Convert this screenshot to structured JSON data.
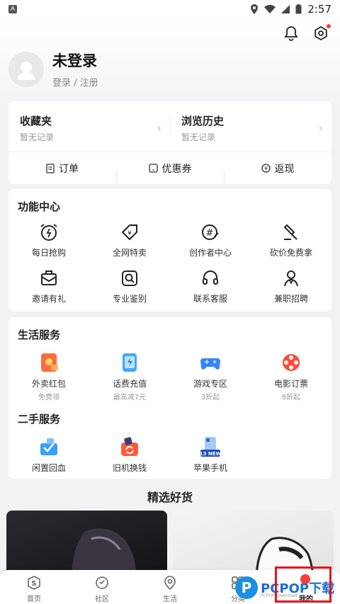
{
  "status_bar": {
    "time": "2:57"
  },
  "profile": {
    "name": "未登录",
    "sub": "登录 / 注册"
  },
  "collections": [
    {
      "title": "收藏夹",
      "sub": "暂无记录"
    },
    {
      "title": "浏览历史",
      "sub": "暂无记录"
    }
  ],
  "orders": [
    {
      "label": "订单",
      "icon": "receipt-icon"
    },
    {
      "label": "优惠券",
      "icon": "coupon-icon"
    },
    {
      "label": "返现",
      "icon": "cashback-icon"
    }
  ],
  "functions": {
    "title": "功能中心",
    "items": [
      {
        "label": "每日抢购",
        "icon": "alarm-clock-icon"
      },
      {
        "label": "全网特卖",
        "icon": "price-tag-icon"
      },
      {
        "label": "创作者中心",
        "icon": "hashtag-icon"
      },
      {
        "label": "砍价免费拿",
        "icon": "hammer-icon"
      },
      {
        "label": "邀请有礼",
        "icon": "envelope-icon"
      },
      {
        "label": "专业鉴别",
        "icon": "magnifier-icon"
      },
      {
        "label": "联系客服",
        "icon": "headset-icon"
      },
      {
        "label": "兼职招聘",
        "icon": "person-icon"
      }
    ]
  },
  "life": {
    "title": "生活服务",
    "items": [
      {
        "label": "外卖红包",
        "sub": "免费领",
        "icon": "red-packet-icon",
        "color": "#ff6a3d"
      },
      {
        "label": "话费充值",
        "sub": "最高减7元",
        "icon": "phone-charge-icon",
        "color": "#3ea8ff"
      },
      {
        "label": "游戏专区",
        "sub": "3折起",
        "icon": "gamepad-icon",
        "color": "#3b82f6"
      },
      {
        "label": "电影订票",
        "sub": "8折起",
        "icon": "film-reel-icon",
        "color": "#ff4b3a"
      }
    ]
  },
  "second_hand": {
    "title": "二手服务",
    "items": [
      {
        "label": "闲置回血",
        "icon": "idle-trade-icon",
        "color": "#3aa0ff"
      },
      {
        "label": "旧机换钱",
        "icon": "phone-trade-icon",
        "color": "#ff5a3c"
      },
      {
        "label": "苹果手机",
        "icon": "iphone-icon",
        "color": "#2b6fe0",
        "badge": "13 NEW"
      }
    ]
  },
  "picks": {
    "title": "精选好货"
  },
  "tabbar": [
    {
      "label": "首页",
      "icon": "home-s-icon"
    },
    {
      "label": "社区",
      "icon": "community-icon"
    },
    {
      "label": "生活",
      "icon": "location-icon"
    },
    {
      "label": "分类",
      "icon": "category-icon"
    },
    {
      "label": "我的",
      "icon": "profile-icon"
    }
  ],
  "watermark": {
    "logo": "P",
    "text": "PCPOP下载",
    "sub": "PCPOP Download"
  }
}
